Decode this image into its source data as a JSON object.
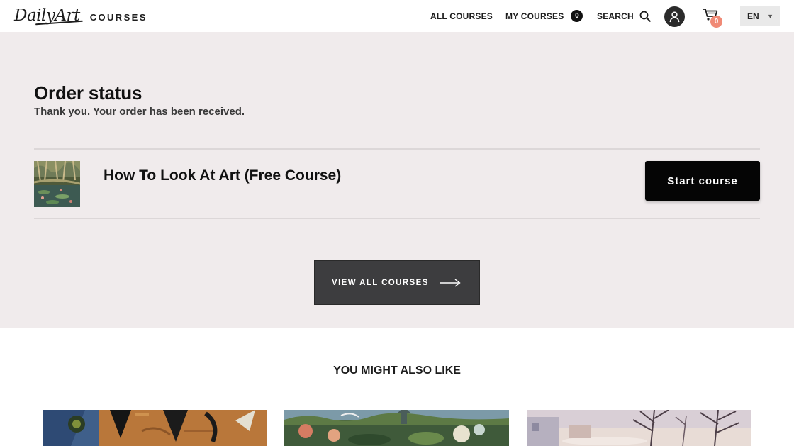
{
  "header": {
    "logo_script": "DailyArt",
    "logo_word": "COURSES",
    "nav": {
      "all_courses": "ALL COURSES",
      "my_courses": "MY COURSES",
      "my_courses_count": "0",
      "search": "SEARCH"
    },
    "cart_count": "0",
    "language": "EN",
    "icons": [
      "search-icon",
      "user-icon",
      "cart-icon",
      "caret-down-icon"
    ]
  },
  "order": {
    "title": "Order status",
    "message": "Thank you. Your order has been received.",
    "item": {
      "name": "How To Look At Art (Free Course)",
      "button": "Start course"
    },
    "view_all_button": "VIEW ALL COURSES",
    "colors": {
      "section_bg": "#f0ebec",
      "button_dark": "#050505",
      "view_all_bg": "#3d3d3f",
      "badge": "#f08a76"
    }
  },
  "recommendations": {
    "title": "YOU MIGHT ALSO LIKE"
  }
}
